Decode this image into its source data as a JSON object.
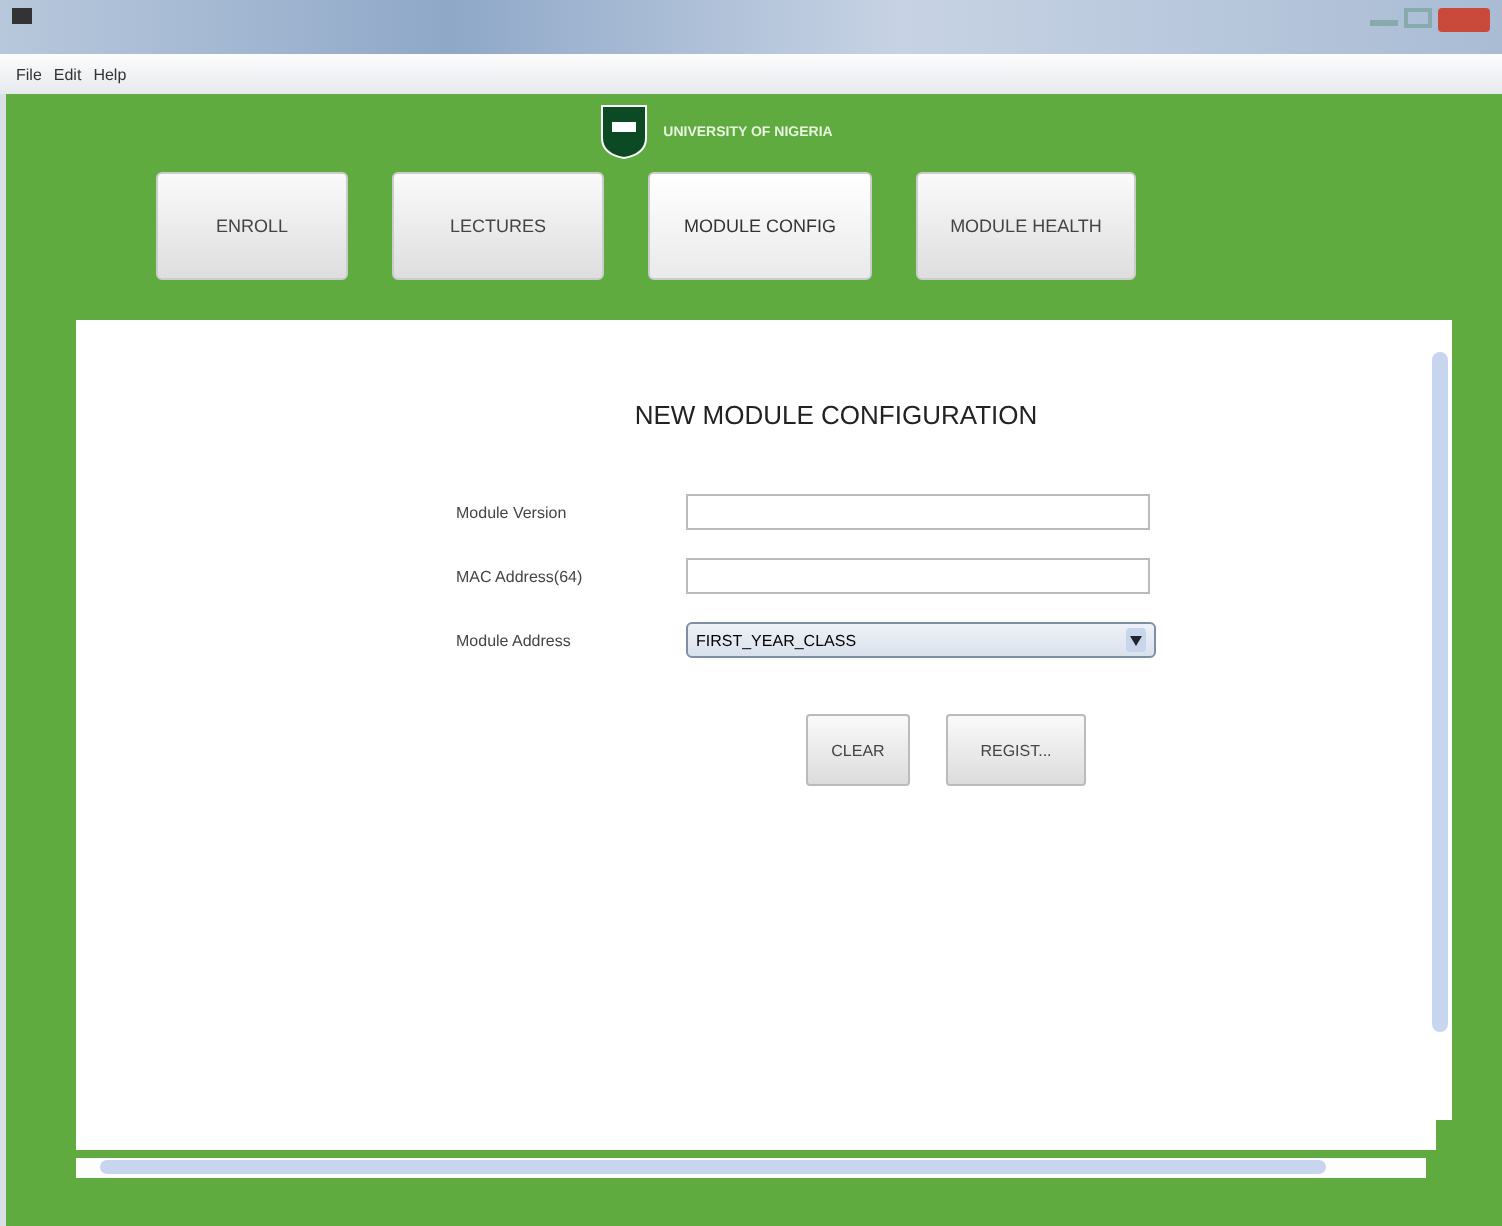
{
  "menu": [
    "File",
    "Edit",
    "Help"
  ],
  "logo": {
    "title": "UNIVERSITY OF NIGERIA"
  },
  "nav": [
    {
      "label": "ENROLL",
      "selected": false
    },
    {
      "label": "LECTURES",
      "selected": false
    },
    {
      "label": "MODULE CONFIG",
      "selected": true
    },
    {
      "label": "MODULE HEALTH",
      "selected": false
    }
  ],
  "form": {
    "title": "NEW MODULE CONFIGURATION",
    "fields": [
      {
        "kind": "text",
        "label": "Module Version"
      },
      {
        "kind": "text",
        "label": "MAC Address(64)"
      },
      {
        "kind": "select",
        "label": "Module Address",
        "value": "FIRST_YEAR_CLASS"
      }
    ],
    "buttons": [
      "CLEAR",
      "REGIST..."
    ]
  }
}
